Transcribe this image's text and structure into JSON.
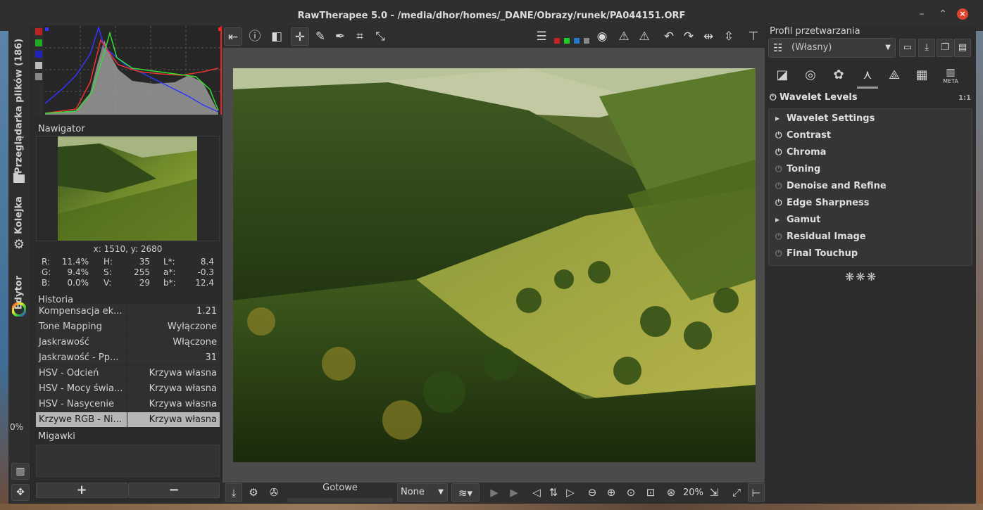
{
  "window": {
    "title": "RawTherapee 5.0 - /media/dhor/homes/_DANE/Obrazy/runek/PA044151.ORF",
    "controls": [
      "minimize-icon",
      "maximize-icon",
      "close-icon"
    ]
  },
  "vertical_tabs": [
    {
      "label": "Przeglądarka plików (186)",
      "icon": "folder-icon"
    },
    {
      "label": "Kolejka",
      "icon": "gear-icon"
    },
    {
      "label": "Edytor",
      "icon": "color-wheel-icon"
    }
  ],
  "left_panel": {
    "navigator_title": "Nawigator",
    "coordinates": "x: 1510, y: 2680",
    "pixel_values": {
      "rgb": [
        [
          "R:",
          "11.4%"
        ],
        [
          "G:",
          "9.4%"
        ],
        [
          "B:",
          "0.0%"
        ]
      ],
      "hsv": [
        [
          "H:",
          "35"
        ],
        [
          "S:",
          "255"
        ],
        [
          "V:",
          "29"
        ]
      ],
      "lab": [
        [
          "L*:",
          "8.4"
        ],
        [
          "a*:",
          "-0.3"
        ],
        [
          "b*:",
          "12.4"
        ]
      ]
    },
    "history_title": "Historia",
    "history": [
      {
        "name": "Kompensacja ek...",
        "value": "1.21"
      },
      {
        "name": "Tone Mapping",
        "value": "Wyłączone"
      },
      {
        "name": "Jaskrawość",
        "value": "Włączone"
      },
      {
        "name": "Jaskrawość - Pp...",
        "value": "31"
      },
      {
        "name": "HSV - Odcień",
        "value": "Krzywa własna"
      },
      {
        "name": "HSV - Mocy świa...",
        "value": "Krzywa własna"
      },
      {
        "name": "HSV - Nasycenie",
        "value": "Krzywa własna"
      },
      {
        "name": "Krzywe RGB - Ni...",
        "value": "Krzywa własna",
        "selected": true
      }
    ],
    "snapshots_title": "Migawki",
    "add_label": "+",
    "remove_label": "−",
    "zoom_percent": "0%"
  },
  "top_toolbar": {
    "icons": [
      "hide-left-panel-icon",
      "info-icon",
      "before-after-icon",
      "hand-icon",
      "color-picker-icon",
      "white-balance-picker-icon",
      "crop-icon",
      "straighten-icon",
      "preview-modes-icon",
      "focus-mask-icon",
      "warning-shadow-icon",
      "warning-highlight-icon",
      "rotate-left-icon",
      "rotate-right-icon",
      "flip-horizontal-icon",
      "flip-vertical-icon",
      "hide-right-panel-icon"
    ]
  },
  "bottom_bar": {
    "status": "Gotowe",
    "queue_select": "None",
    "zoom_level": "20%",
    "icons": [
      "save-icon",
      "queue-add-icon",
      "external-editor-icon",
      "previous-icon",
      "sync-icon",
      "next-icon",
      "zoom-out-icon",
      "zoom-in-icon",
      "zoom-fit-icon",
      "zoom-crop-icon",
      "zoom-100-icon",
      "new-window-icon",
      "fullscreen-icon",
      "hide-right-icon"
    ]
  },
  "right_panel": {
    "profile_title": "Profil przetwarzania",
    "profile_value": "(Własny)",
    "tool_tabs": [
      "exposure-tab-icon",
      "detail-tab-icon",
      "color-tab-icon",
      "wavelet-tab-icon",
      "transform-tab-icon",
      "raw-tab-icon",
      "metadata-tab-icon"
    ],
    "meta_label": "META",
    "section_title": "Wavelet Levels",
    "section_badge": "1:1",
    "items": [
      {
        "label": "Wavelet Settings",
        "type": "expander"
      },
      {
        "label": "Contrast",
        "type": "on"
      },
      {
        "label": "Chroma",
        "type": "on"
      },
      {
        "label": "Toning",
        "type": "off"
      },
      {
        "label": "Denoise and Refine",
        "type": "off"
      },
      {
        "label": "Edge Sharpness",
        "type": "on"
      },
      {
        "label": "Gamut",
        "type": "expander"
      },
      {
        "label": "Residual Image",
        "type": "off"
      },
      {
        "label": "Final Touchup",
        "type": "off"
      }
    ],
    "ornament": "❋❋❋"
  }
}
